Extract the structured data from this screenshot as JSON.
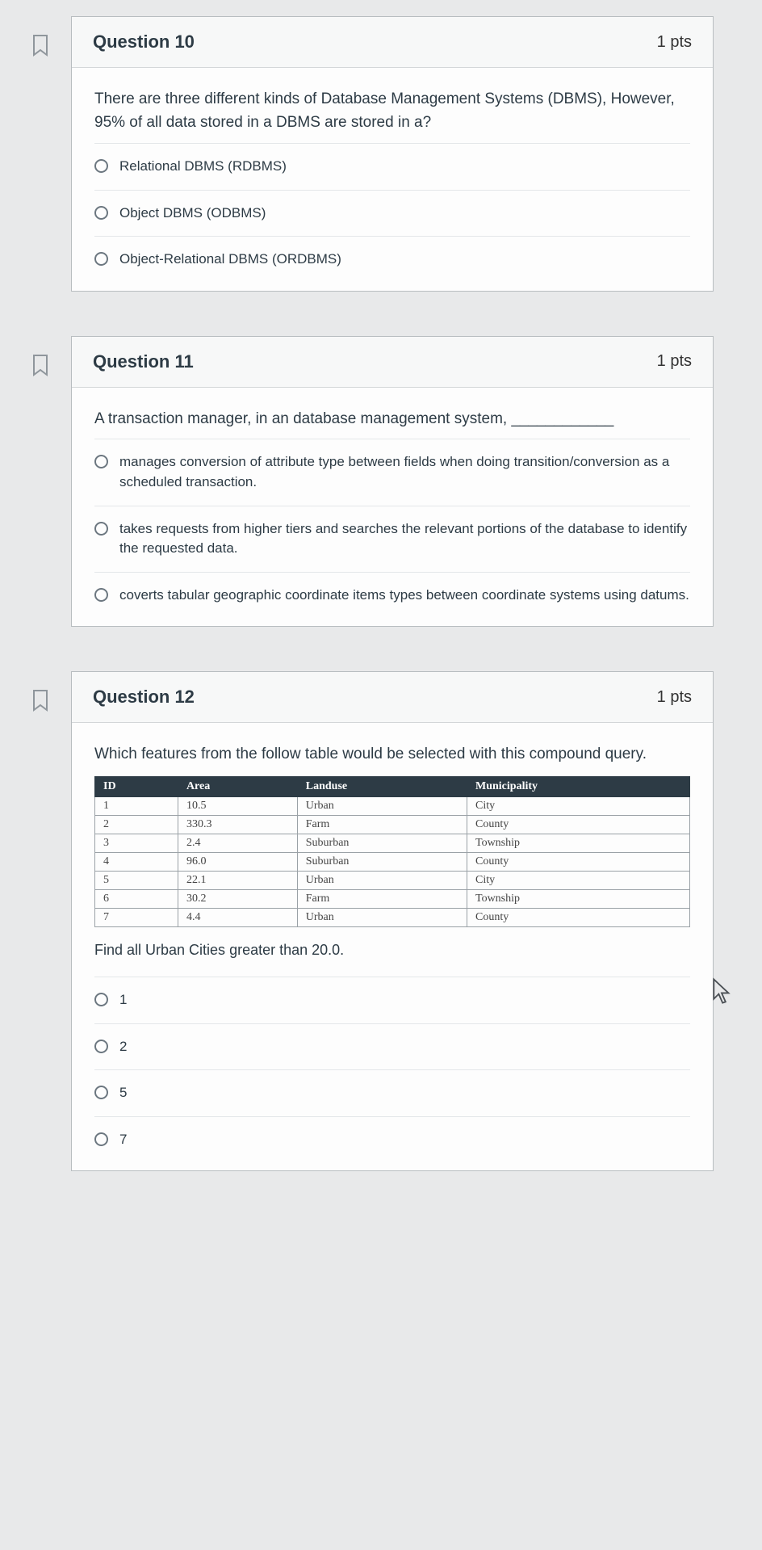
{
  "questions": [
    {
      "number": "Question 10",
      "pts": "1 pts",
      "stem": "There are three different kinds of Database Management Systems (DBMS), However, 95% of all data stored in a DBMS are stored in a?",
      "options": [
        "Relational DBMS (RDBMS)",
        "Object DBMS (ODBMS)",
        "Object-Relational DBMS (ORDBMS)"
      ]
    },
    {
      "number": "Question 11",
      "pts": "1 pts",
      "stem": "A transaction manager, in an database management system, ____________",
      "options": [
        "manages conversion of attribute type between fields when doing transition/conversion as a scheduled transaction.",
        "takes requests from higher tiers and searches the relevant portions of the database to identify the requested data.",
        "coverts tabular geographic coordinate items types between coordinate systems using datums."
      ]
    },
    {
      "number": "Question 12",
      "pts": "1 pts",
      "stem": "Which features from the follow table would be selected with this compound query.",
      "table": {
        "headers": [
          "ID",
          "Area",
          "Landuse",
          "Municipality"
        ],
        "rows": [
          [
            "1",
            "10.5",
            "Urban",
            "City"
          ],
          [
            "2",
            "330.3",
            "Farm",
            "County"
          ],
          [
            "3",
            "2.4",
            "Suburban",
            "Township"
          ],
          [
            "4",
            "96.0",
            "Suburban",
            "County"
          ],
          [
            "5",
            "22.1",
            "Urban",
            "City"
          ],
          [
            "6",
            "30.2",
            "Farm",
            "Township"
          ],
          [
            "7",
            "4.4",
            "Urban",
            "County"
          ]
        ]
      },
      "followup": "Find all Urban Cities greater than 20.0.",
      "options": [
        "1",
        "2",
        "5",
        "7"
      ]
    }
  ]
}
